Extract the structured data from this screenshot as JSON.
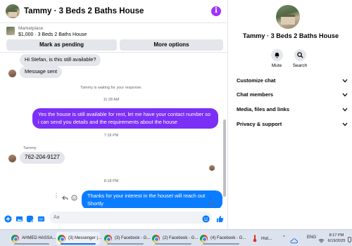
{
  "header": {
    "title": "Tammy · 3 Beds 2 Baths House"
  },
  "marketplace": {
    "source": "Marketplace",
    "listing": "$1,000 · 3 Beds 2 Baths House",
    "pending_label": "Mark as pending",
    "more_label": "More options"
  },
  "messages": {
    "m1": "Hi Stefan, is this still available?",
    "m2": "Message sent",
    "waiting_note": "Tammy is waiting for your response.",
    "time1": "11:28 AM",
    "m3": "Yes the house is still available for rent, let me have your contact number so i can send you details and the requirements about the house",
    "time2": "7:18 PM",
    "sender": "Tammy",
    "m4": "762-204-9127",
    "time3": "8:18 PM",
    "m5": "Thanks for your interest in the houseI will reach out Shortly",
    "status": "Sent"
  },
  "composer": {
    "placeholder": "Aa"
  },
  "info_panel": {
    "title": "Tammy · 3 Beds 2 Baths House",
    "actions": [
      {
        "label": "Mute",
        "icon": "bell-icon"
      },
      {
        "label": "Search",
        "icon": "search-icon"
      }
    ],
    "sections": [
      "Customize chat",
      "Chat members",
      "Media, files and links",
      "Privacy & support"
    ]
  },
  "taskbar": {
    "items": [
      "AHMED HASSA...",
      "(3) Messenger |...",
      "(3) Facebook - G...",
      "(2) Facebook - G...",
      "(4) Facebook - G..."
    ],
    "weather": "Hot...",
    "lang": "ENG",
    "time": "8:17 PM",
    "date": "6/19/2025"
  },
  "colors": {
    "accent_purple": "#7b2ff7",
    "accent_blue": "#0a7cff",
    "info_purple": "#a033ff"
  }
}
